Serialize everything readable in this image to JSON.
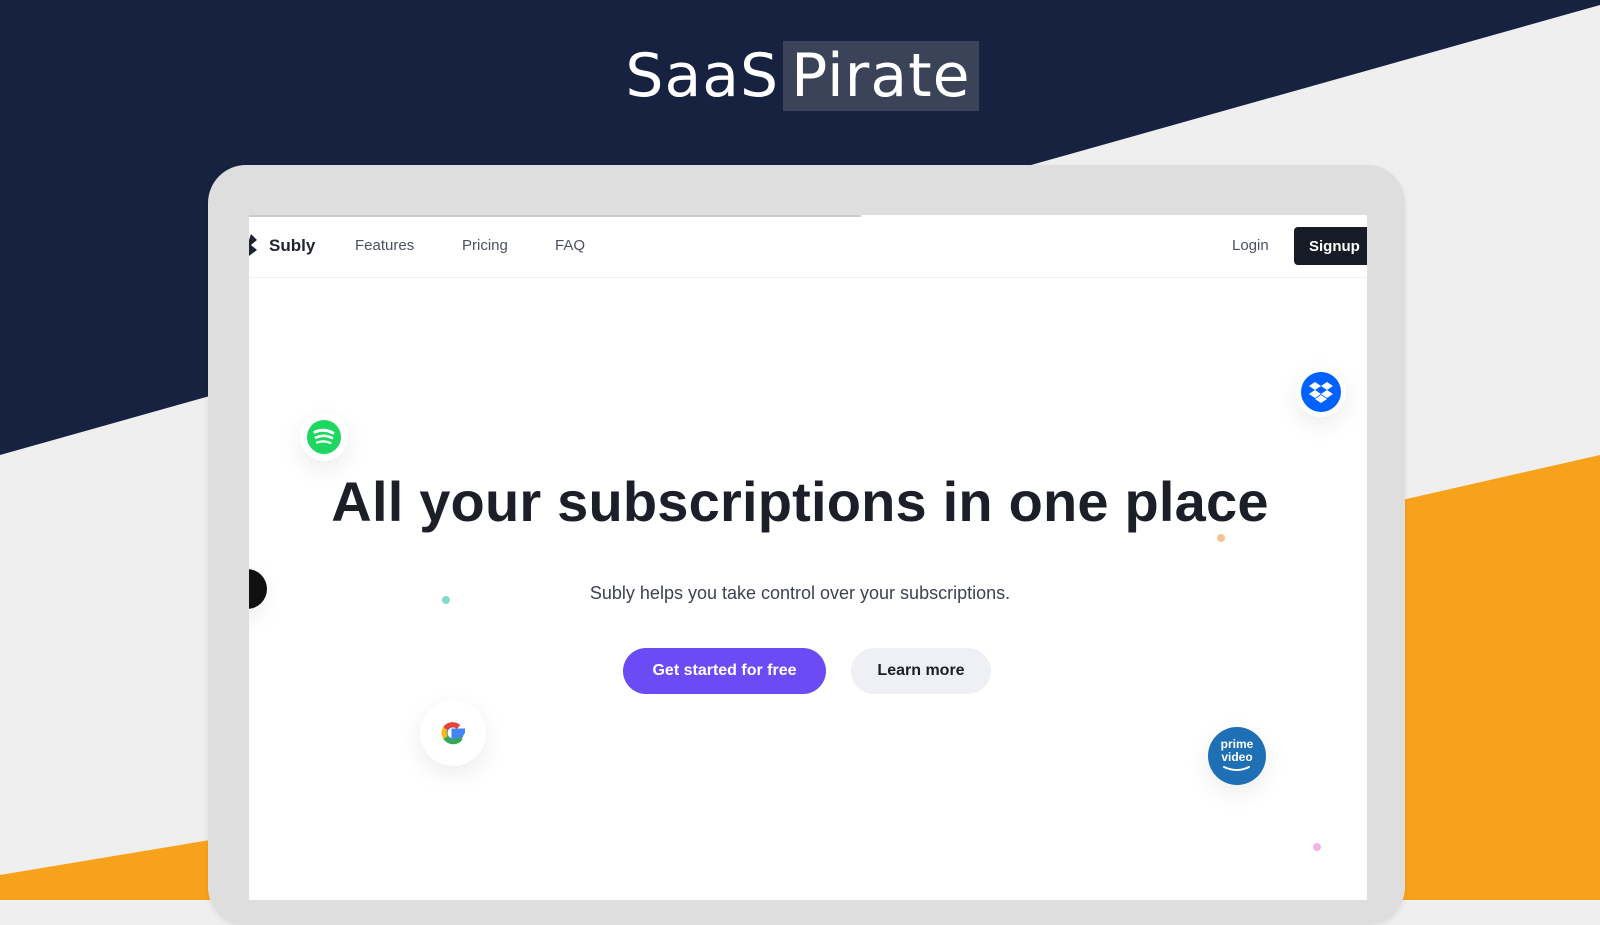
{
  "banner": {
    "brand_part1": "SaaS",
    "brand_part2": "Pirate"
  },
  "nav": {
    "logo": "Subly",
    "links": [
      "Features",
      "Pricing",
      "FAQ"
    ],
    "login": "Login",
    "signup": "Signup"
  },
  "hero": {
    "headline": "All your subscriptions in one place",
    "subtitle": "Subly helps you take control over your subscriptions.",
    "primary_cta": "Get started for free",
    "secondary_cta": "Learn more"
  },
  "floating_icons": {
    "prime_line1": "prime",
    "prime_line2": "video"
  },
  "colors": {
    "navy": "#172240",
    "orange": "#f7a21b",
    "primary": "#6a4bf4",
    "spotify": "#1ed760",
    "dropbox": "#0061fe"
  },
  "icons": [
    "spotify-icon",
    "dropbox-icon",
    "google-icon",
    "prime-video-icon",
    "subly-logo-icon"
  ]
}
